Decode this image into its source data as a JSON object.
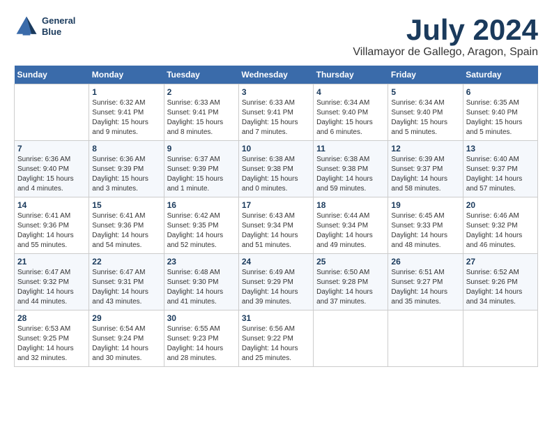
{
  "header": {
    "logo_line1": "General",
    "logo_line2": "Blue",
    "month_title": "July 2024",
    "location": "Villamayor de Gallego, Aragon, Spain"
  },
  "days_of_week": [
    "Sunday",
    "Monday",
    "Tuesday",
    "Wednesday",
    "Thursday",
    "Friday",
    "Saturday"
  ],
  "weeks": [
    [
      {
        "day": "",
        "sunrise": "",
        "sunset": "",
        "daylight": ""
      },
      {
        "day": "1",
        "sunrise": "Sunrise: 6:32 AM",
        "sunset": "Sunset: 9:41 PM",
        "daylight": "Daylight: 15 hours and 9 minutes."
      },
      {
        "day": "2",
        "sunrise": "Sunrise: 6:33 AM",
        "sunset": "Sunset: 9:41 PM",
        "daylight": "Daylight: 15 hours and 8 minutes."
      },
      {
        "day": "3",
        "sunrise": "Sunrise: 6:33 AM",
        "sunset": "Sunset: 9:41 PM",
        "daylight": "Daylight: 15 hours and 7 minutes."
      },
      {
        "day": "4",
        "sunrise": "Sunrise: 6:34 AM",
        "sunset": "Sunset: 9:40 PM",
        "daylight": "Daylight: 15 hours and 6 minutes."
      },
      {
        "day": "5",
        "sunrise": "Sunrise: 6:34 AM",
        "sunset": "Sunset: 9:40 PM",
        "daylight": "Daylight: 15 hours and 5 minutes."
      },
      {
        "day": "6",
        "sunrise": "Sunrise: 6:35 AM",
        "sunset": "Sunset: 9:40 PM",
        "daylight": "Daylight: 15 hours and 5 minutes."
      }
    ],
    [
      {
        "day": "7",
        "sunrise": "Sunrise: 6:36 AM",
        "sunset": "Sunset: 9:40 PM",
        "daylight": "Daylight: 15 hours and 4 minutes."
      },
      {
        "day": "8",
        "sunrise": "Sunrise: 6:36 AM",
        "sunset": "Sunset: 9:39 PM",
        "daylight": "Daylight: 15 hours and 3 minutes."
      },
      {
        "day": "9",
        "sunrise": "Sunrise: 6:37 AM",
        "sunset": "Sunset: 9:39 PM",
        "daylight": "Daylight: 15 hours and 1 minute."
      },
      {
        "day": "10",
        "sunrise": "Sunrise: 6:38 AM",
        "sunset": "Sunset: 9:38 PM",
        "daylight": "Daylight: 15 hours and 0 minutes."
      },
      {
        "day": "11",
        "sunrise": "Sunrise: 6:38 AM",
        "sunset": "Sunset: 9:38 PM",
        "daylight": "Daylight: 14 hours and 59 minutes."
      },
      {
        "day": "12",
        "sunrise": "Sunrise: 6:39 AM",
        "sunset": "Sunset: 9:37 PM",
        "daylight": "Daylight: 14 hours and 58 minutes."
      },
      {
        "day": "13",
        "sunrise": "Sunrise: 6:40 AM",
        "sunset": "Sunset: 9:37 PM",
        "daylight": "Daylight: 14 hours and 57 minutes."
      }
    ],
    [
      {
        "day": "14",
        "sunrise": "Sunrise: 6:41 AM",
        "sunset": "Sunset: 9:36 PM",
        "daylight": "Daylight: 14 hours and 55 minutes."
      },
      {
        "day": "15",
        "sunrise": "Sunrise: 6:41 AM",
        "sunset": "Sunset: 9:36 PM",
        "daylight": "Daylight: 14 hours and 54 minutes."
      },
      {
        "day": "16",
        "sunrise": "Sunrise: 6:42 AM",
        "sunset": "Sunset: 9:35 PM",
        "daylight": "Daylight: 14 hours and 52 minutes."
      },
      {
        "day": "17",
        "sunrise": "Sunrise: 6:43 AM",
        "sunset": "Sunset: 9:34 PM",
        "daylight": "Daylight: 14 hours and 51 minutes."
      },
      {
        "day": "18",
        "sunrise": "Sunrise: 6:44 AM",
        "sunset": "Sunset: 9:34 PM",
        "daylight": "Daylight: 14 hours and 49 minutes."
      },
      {
        "day": "19",
        "sunrise": "Sunrise: 6:45 AM",
        "sunset": "Sunset: 9:33 PM",
        "daylight": "Daylight: 14 hours and 48 minutes."
      },
      {
        "day": "20",
        "sunrise": "Sunrise: 6:46 AM",
        "sunset": "Sunset: 9:32 PM",
        "daylight": "Daylight: 14 hours and 46 minutes."
      }
    ],
    [
      {
        "day": "21",
        "sunrise": "Sunrise: 6:47 AM",
        "sunset": "Sunset: 9:32 PM",
        "daylight": "Daylight: 14 hours and 44 minutes."
      },
      {
        "day": "22",
        "sunrise": "Sunrise: 6:47 AM",
        "sunset": "Sunset: 9:31 PM",
        "daylight": "Daylight: 14 hours and 43 minutes."
      },
      {
        "day": "23",
        "sunrise": "Sunrise: 6:48 AM",
        "sunset": "Sunset: 9:30 PM",
        "daylight": "Daylight: 14 hours and 41 minutes."
      },
      {
        "day": "24",
        "sunrise": "Sunrise: 6:49 AM",
        "sunset": "Sunset: 9:29 PM",
        "daylight": "Daylight: 14 hours and 39 minutes."
      },
      {
        "day": "25",
        "sunrise": "Sunrise: 6:50 AM",
        "sunset": "Sunset: 9:28 PM",
        "daylight": "Daylight: 14 hours and 37 minutes."
      },
      {
        "day": "26",
        "sunrise": "Sunrise: 6:51 AM",
        "sunset": "Sunset: 9:27 PM",
        "daylight": "Daylight: 14 hours and 35 minutes."
      },
      {
        "day": "27",
        "sunrise": "Sunrise: 6:52 AM",
        "sunset": "Sunset: 9:26 PM",
        "daylight": "Daylight: 14 hours and 34 minutes."
      }
    ],
    [
      {
        "day": "28",
        "sunrise": "Sunrise: 6:53 AM",
        "sunset": "Sunset: 9:25 PM",
        "daylight": "Daylight: 14 hours and 32 minutes."
      },
      {
        "day": "29",
        "sunrise": "Sunrise: 6:54 AM",
        "sunset": "Sunset: 9:24 PM",
        "daylight": "Daylight: 14 hours and 30 minutes."
      },
      {
        "day": "30",
        "sunrise": "Sunrise: 6:55 AM",
        "sunset": "Sunset: 9:23 PM",
        "daylight": "Daylight: 14 hours and 28 minutes."
      },
      {
        "day": "31",
        "sunrise": "Sunrise: 6:56 AM",
        "sunset": "Sunset: 9:22 PM",
        "daylight": "Daylight: 14 hours and 25 minutes."
      },
      {
        "day": "",
        "sunrise": "",
        "sunset": "",
        "daylight": ""
      },
      {
        "day": "",
        "sunrise": "",
        "sunset": "",
        "daylight": ""
      },
      {
        "day": "",
        "sunrise": "",
        "sunset": "",
        "daylight": ""
      }
    ]
  ]
}
